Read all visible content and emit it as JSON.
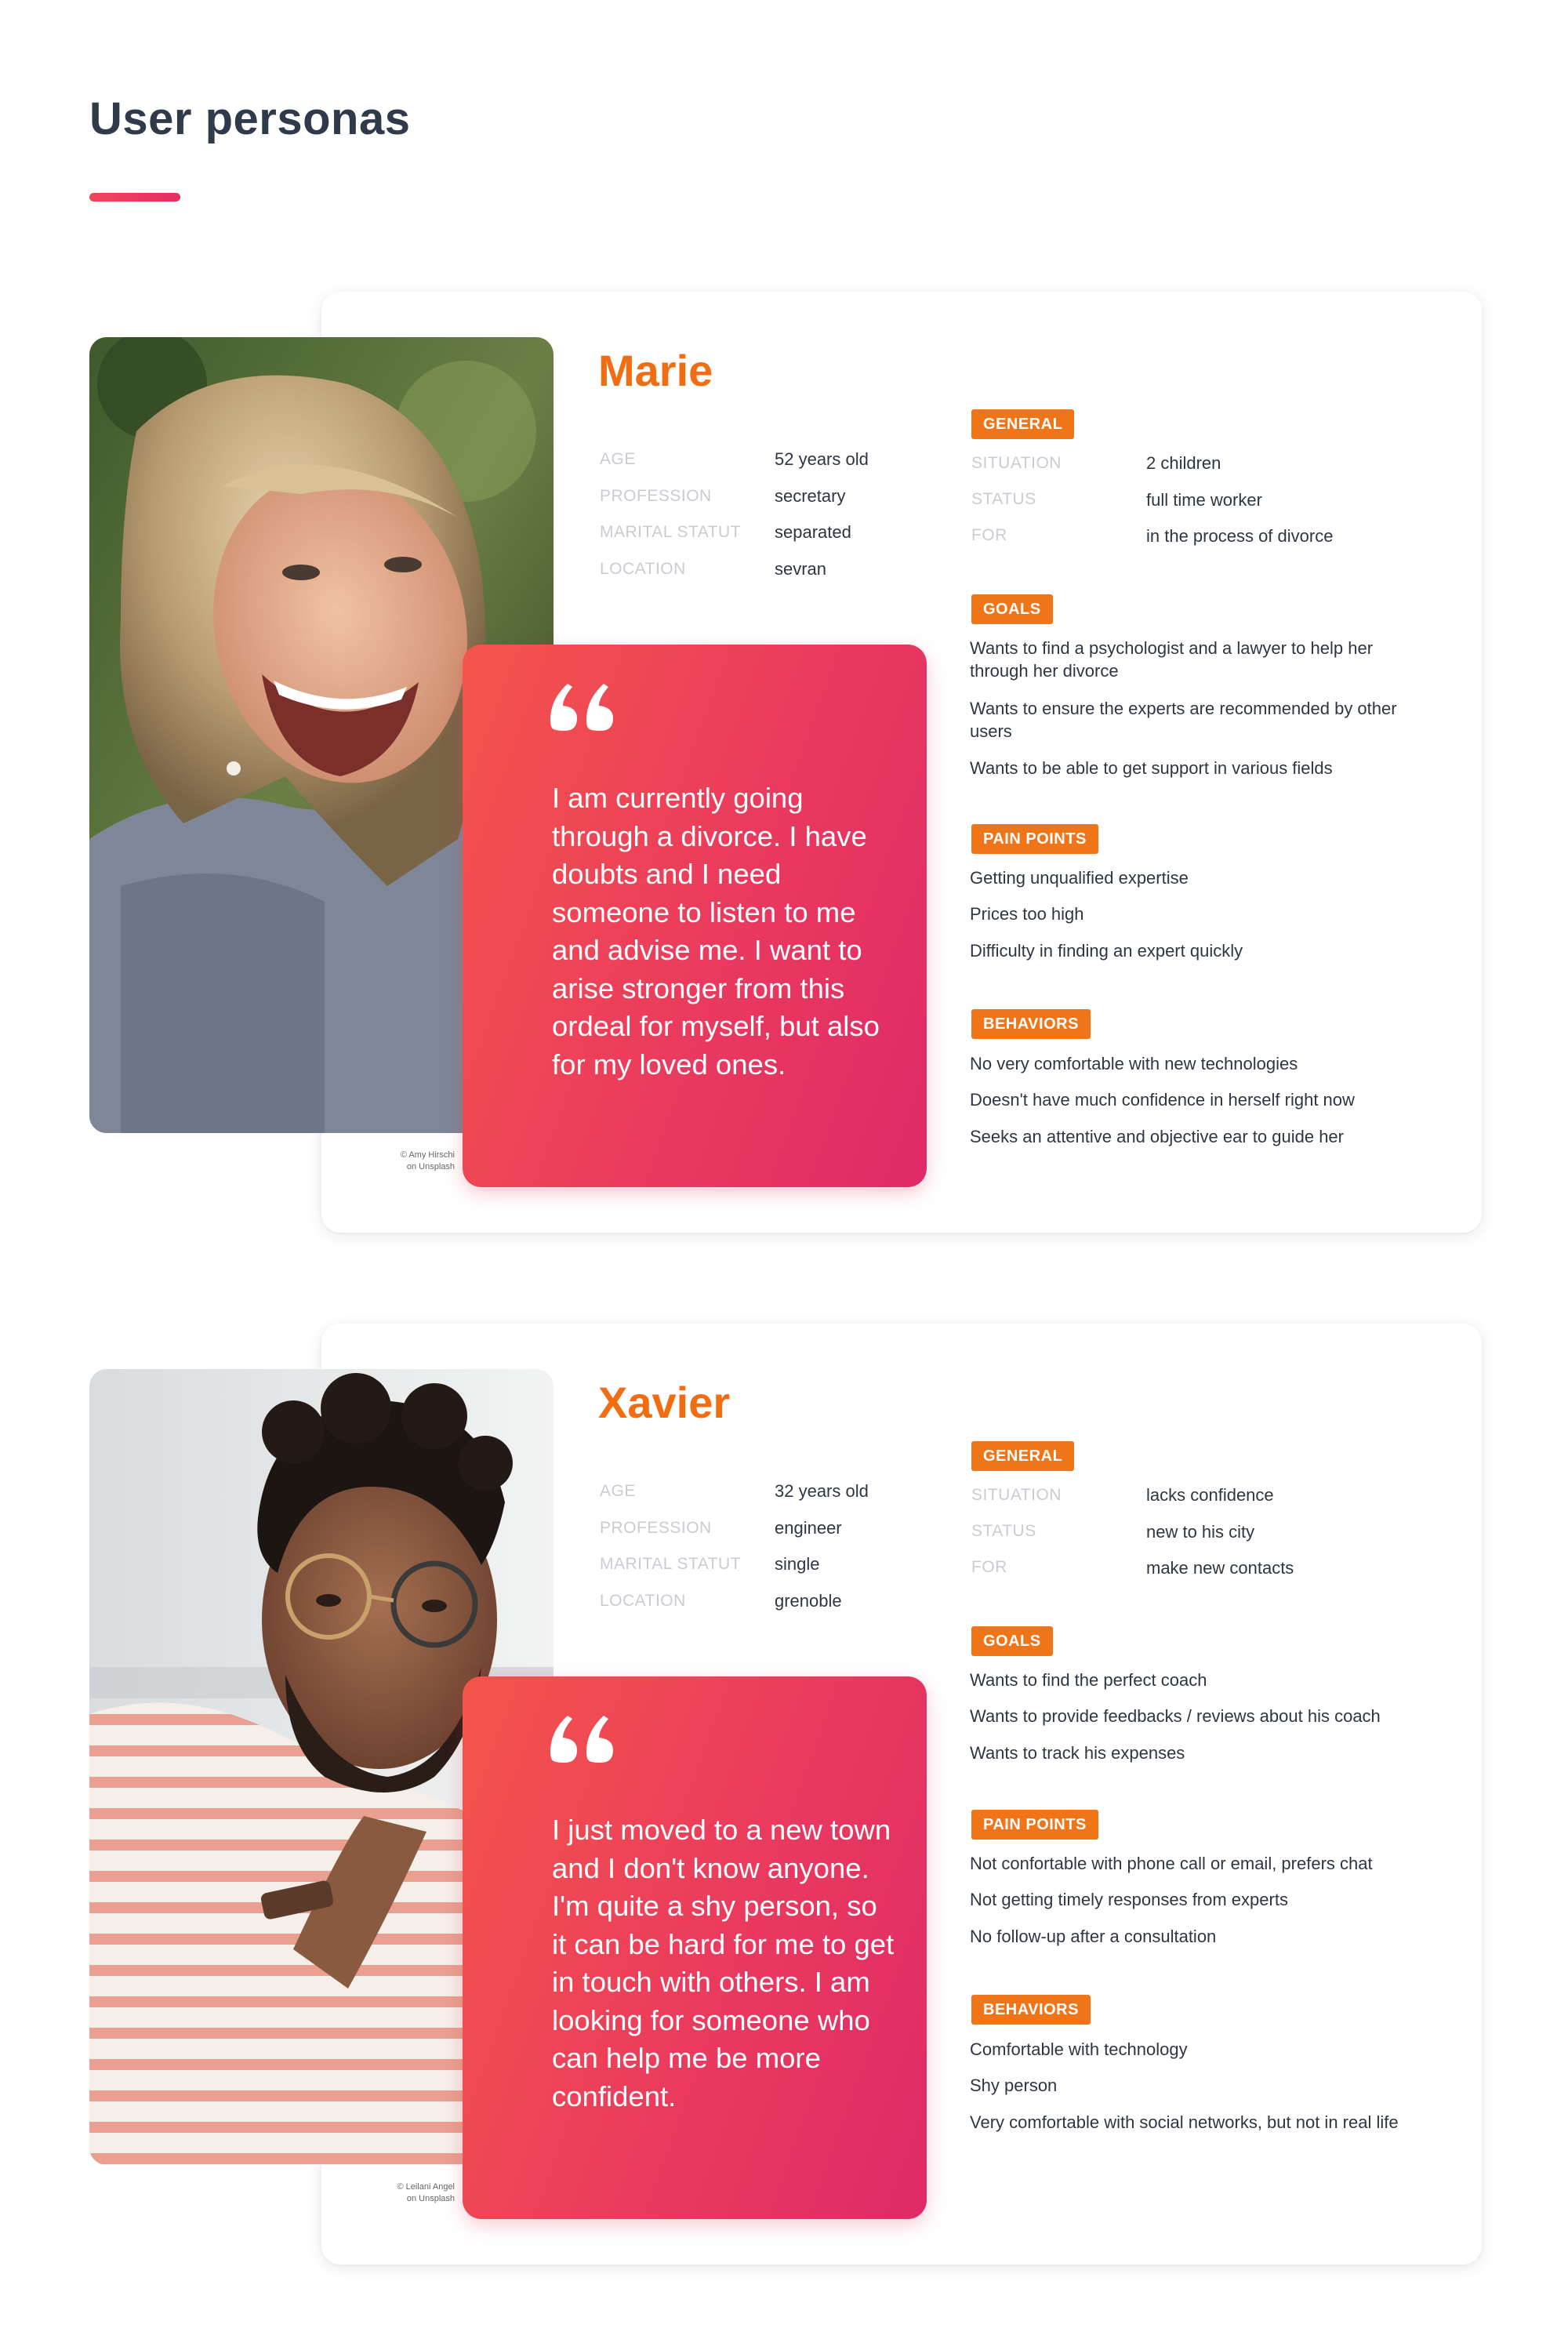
{
  "page": {
    "title": "User personas"
  },
  "colors": {
    "accent_orange": "#f26c12",
    "tag_orange": "#f07519",
    "quote_gradient_start": "#f4554a",
    "quote_gradient_end": "#df2a67",
    "title_underline": "#ec3e5e"
  },
  "personas": [
    {
      "name": "Marie",
      "photo_credit": [
        "© Amy Hirschi",
        "on Unsplash"
      ],
      "quote": "I am currently going through a divorce. I have doubts and I need someone to listen to me and advise me. I want to arise stronger from this ordeal for myself, but also for my loved ones.",
      "info": [
        {
          "label": "AGE",
          "value": "52 years old"
        },
        {
          "label": "PROFESSION",
          "value": "secretary"
        },
        {
          "label": "MARITAL STATUT",
          "value": "separated"
        },
        {
          "label": "LOCATION",
          "value": "sevran"
        }
      ],
      "general_tag": "GENERAL",
      "general": [
        {
          "label": "SITUATION",
          "value": "2 children"
        },
        {
          "label": "STATUS",
          "value": "full time worker"
        },
        {
          "label": "FOR",
          "value": "in the process of divorce"
        }
      ],
      "goals_tag": "GOALS",
      "goals": [
        "Wants to find a psychologist and a lawyer to help her through her divorce",
        "Wants to ensure the experts are recommended by other users",
        "Wants to be able to get support in various fields"
      ],
      "pain_tag": "PAIN POINTS",
      "pain_points": [
        "Getting unqualified expertise",
        "Prices too high",
        "Difficulty in finding an expert quickly"
      ],
      "behaviors_tag": "BEHAVIORS",
      "behaviors": [
        "No very comfortable with new technologies",
        "Doesn't have much confidence in herself right now",
        "Seeks an attentive and objective ear to guide her"
      ]
    },
    {
      "name": "Xavier",
      "photo_credit": [
        "© Leilani Angel",
        "on Unsplash"
      ],
      "quote": "I just moved to a new town and I don't know anyone. I'm quite a shy person, so it can be hard for me to get in touch with others. I am looking for someone who can help me be more confident.",
      "info": [
        {
          "label": "AGE",
          "value": "32 years old"
        },
        {
          "label": "PROFESSION",
          "value": "engineer"
        },
        {
          "label": "MARITAL STATUT",
          "value": "single"
        },
        {
          "label": "LOCATION",
          "value": "grenoble"
        }
      ],
      "general_tag": "GENERAL",
      "general": [
        {
          "label": "SITUATION",
          "value": "lacks confidence"
        },
        {
          "label": "STATUS",
          "value": "new to his city"
        },
        {
          "label": "FOR",
          "value": "make new contacts"
        }
      ],
      "goals_tag": "GOALS",
      "goals": [
        "Wants to find the perfect coach",
        "Wants to provide feedbacks / reviews about his coach",
        "Wants to track his expenses"
      ],
      "pain_tag": "PAIN POINTS",
      "pain_points": [
        "Not confortable with phone call or email, prefers chat",
        "Not getting timely responses from experts",
        "No follow-up after a consultation"
      ],
      "behaviors_tag": "BEHAVIORS",
      "behaviors": [
        "Comfortable with technology",
        "Shy person",
        "Very comfortable with social networks, but not in real life"
      ]
    }
  ]
}
